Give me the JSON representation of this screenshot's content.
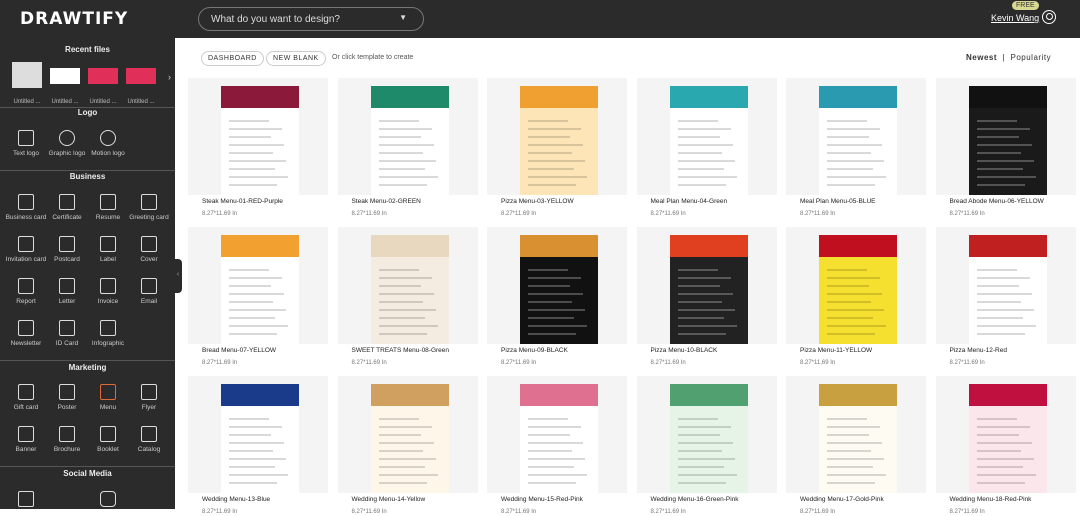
{
  "header": {
    "logo": "DRAWTIFY",
    "search_placeholder": "What do you want to design?",
    "badge": "FREE",
    "user": "Kevin Wang"
  },
  "sidebar": {
    "recent_title": "Recent files",
    "recent": [
      "Untitled ...",
      "Untitled ...",
      "Untitled ...",
      "Untitled ..."
    ],
    "logo_title": "Logo",
    "logo_items": [
      "Text logo",
      "Graphic logo",
      "Motion logo"
    ],
    "business_title": "Business",
    "business_items": [
      "Business card",
      "Certificate",
      "Resume",
      "Greeting card",
      "Invitation card",
      "Postcard",
      "Label",
      "Cover",
      "Report",
      "Letter",
      "Invoice",
      "Email",
      "Newsletter",
      "ID Card",
      "Infographic"
    ],
    "marketing_title": "Marketing",
    "marketing_items": [
      "Gift card",
      "Poster",
      "Menu",
      "Flyer",
      "Banner",
      "Brochure",
      "Booklet",
      "Catalog"
    ],
    "social_title": "Social Media"
  },
  "toolbar": {
    "dashboard": "DASHBOARD",
    "new_blank": "NEW BLANK",
    "hint": "Or click template to create",
    "sort_newest": "Newest",
    "sort_sep": "|",
    "sort_popularity": "Popularity"
  },
  "templates": [
    {
      "name": "Steak Menu-01-RED-Purple",
      "size": "8.27*11.69 In",
      "color": "#8b1a3a",
      "bg": "#ffffff"
    },
    {
      "name": "Steak Menu-02-GREEN",
      "size": "8.27*11.69 In",
      "color": "#1f8a6a",
      "bg": "#ffffff"
    },
    {
      "name": "Pizza Menu-03-YELLOW",
      "size": "8.27*11.69 In",
      "color": "#f0a030",
      "bg": "#fde5b8"
    },
    {
      "name": "Meal Plan Menu-04-Green",
      "size": "8.27*11.69 In",
      "color": "#2aa8b0",
      "bg": "#ffffff"
    },
    {
      "name": "Meal Plan Menu-05-BLUE",
      "size": "8.27*11.69 In",
      "color": "#2a9ab0",
      "bg": "#ffffff"
    },
    {
      "name": "Bread Abode Menu-06-YELLOW",
      "size": "8.27*11.69 In",
      "color": "#111111",
      "bg": "#1a1a1a"
    },
    {
      "name": "Bread Menu-07-YELLOW",
      "size": "8.27*11.69 In",
      "color": "#f2a030",
      "bg": "#ffffff"
    },
    {
      "name": "SWEET TREATS Menu-08-Green",
      "size": "8.27*11.69 In",
      "color": "#e8d8c0",
      "bg": "#f4ece0"
    },
    {
      "name": "Pizza Menu-09-BLACK",
      "size": "8.27*11.69 In",
      "color": "#d89030",
      "bg": "#111111"
    },
    {
      "name": "Pizza Menu-10-BLACK",
      "size": "8.27*11.69 In",
      "color": "#e04020",
      "bg": "#222222"
    },
    {
      "name": "Pizza Menu-11-YELLOW",
      "size": "8.27*11.69 In",
      "color": "#c01020",
      "bg": "#f5e030"
    },
    {
      "name": "Pizza Menu-12-Red",
      "size": "8.27*11.69 In",
      "color": "#c02020",
      "bg": "#ffffff"
    },
    {
      "name": "Wedding Menu-13-Blue",
      "size": "8.27*11.69 In",
      "color": "#1a3a8a",
      "bg": "#ffffff"
    },
    {
      "name": "Wedding Menu-14-Yellow",
      "size": "8.27*11.69 In",
      "color": "#d0a060",
      "bg": "#fff6ea"
    },
    {
      "name": "Wedding Menu-15-Red-Pink",
      "size": "8.27*11.69 In",
      "color": "#e07090",
      "bg": "#ffffff"
    },
    {
      "name": "Wedding Menu-16-Green-Pink",
      "size": "8.27*11.69 In",
      "color": "#50a070",
      "bg": "#e6f4e8"
    },
    {
      "name": "Wedding Menu-17-Gold-Pink",
      "size": "8.27*11.69 In",
      "color": "#c9a040",
      "bg": "#fdfbf2"
    },
    {
      "name": "Wedding Menu-18-Red-Pink",
      "size": "8.27*11.69 In",
      "color": "#c01040",
      "bg": "#fbe6ec"
    }
  ]
}
